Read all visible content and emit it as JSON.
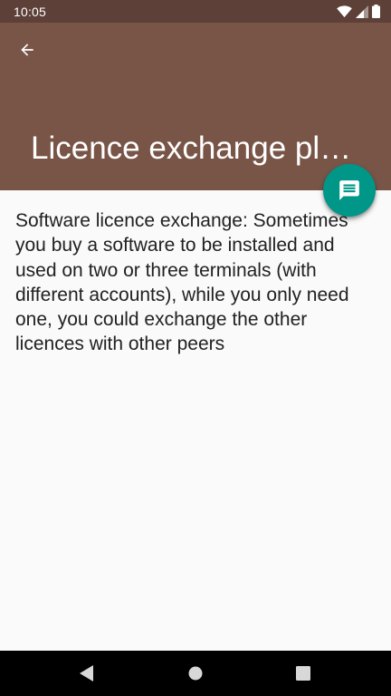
{
  "status_bar": {
    "time": "10:05",
    "icons": [
      "wifi-icon",
      "cell-signal-icon",
      "battery-icon"
    ]
  },
  "app_bar": {
    "title": "Licence exchange pla…",
    "background_color": "#795548",
    "status_color": "#5d4037",
    "back_icon": "arrow-back-icon"
  },
  "fab": {
    "icon": "message-icon",
    "color": "#009688"
  },
  "content": {
    "text": "Software licence exchange: Sometimes you buy a software to be installed and used on two or three terminals (with different accounts), while you only need one, you could exchange the other licences with other peers"
  },
  "nav_bar": {
    "icons": [
      "nav-back-icon",
      "nav-home-icon",
      "nav-recents-icon"
    ]
  }
}
